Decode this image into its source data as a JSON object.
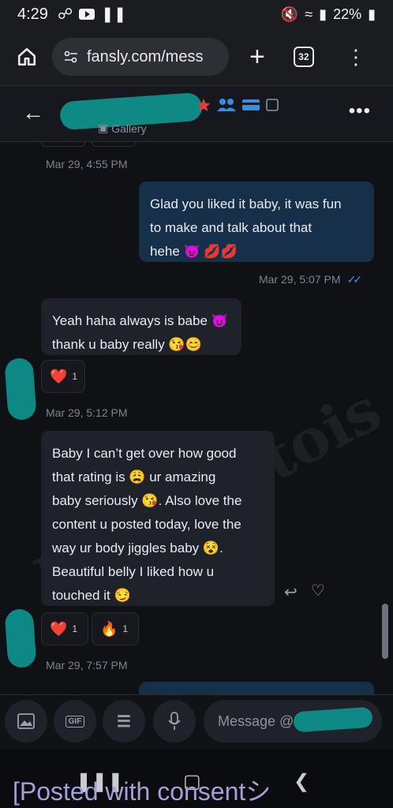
{
  "status_bar": {
    "time": "4:29",
    "battery": "22%"
  },
  "browser": {
    "url": "fansly.com/mess",
    "tab_count": "32"
  },
  "header": {
    "gallery_label": "Gallery"
  },
  "messages": [
    {
      "kind": "timestamp",
      "text": "Mar 29, 4:55 PM"
    },
    {
      "kind": "outgoing",
      "lines": [
        "Glad you liked it baby, it was fun",
        "to make and talk about that",
        "hehe 😈 💋💋"
      ]
    },
    {
      "kind": "timestamp_out",
      "text": "Mar 29, 5:07 PM"
    },
    {
      "kind": "incoming",
      "lines": [
        "Yeah haha always is babe 😈",
        "thank u baby really 😘😊"
      ]
    },
    {
      "kind": "reaction",
      "emoji": "❤️",
      "count": "1"
    },
    {
      "kind": "timestamp",
      "text": "Mar 29, 5:12 PM"
    },
    {
      "kind": "incoming",
      "lines": [
        "Baby I can’t get over how good",
        "that rating is 😩 ur amazing",
        "baby seriously 😘. Also love the",
        "content u posted today, love the",
        "way ur body jiggles baby 😵. ",
        "Beautiful belly I liked how u",
        "touched it 😏"
      ]
    },
    {
      "kind": "reaction",
      "emoji": "❤️",
      "count": "1",
      "emoji2": "🔥",
      "count2": "1"
    },
    {
      "kind": "timestamp",
      "text": "Mar 29, 7:57 PM"
    }
  ],
  "composer": {
    "gif_label": "GIF",
    "placeholder": "Message @"
  },
  "watermark": "Miss Artois",
  "caption": "[Posted with consent",
  "caption_suffix": "シ"
}
